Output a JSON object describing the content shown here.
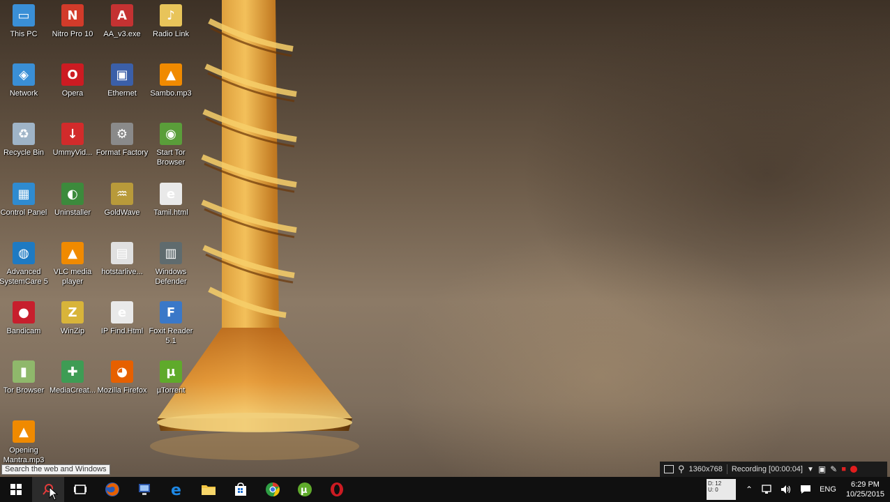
{
  "desktop": {
    "icons": [
      {
        "label": "This PC",
        "icon": "this-pc-icon",
        "color": "#3a8fd6"
      },
      {
        "label": "Nitro Pro 10",
        "icon": "nitro-pro-icon",
        "color": "#d23b2a"
      },
      {
        "label": "AA_v3.exe",
        "icon": "ammyy-admin-icon",
        "color": "#c43232"
      },
      {
        "label": "Radio Link",
        "icon": "radio-link-icon",
        "color": "#e8c45a"
      },
      {
        "label": "Network",
        "icon": "network-icon",
        "color": "#3a8fd6"
      },
      {
        "label": "Opera",
        "icon": "opera-icon",
        "color": "#cc1b22"
      },
      {
        "label": "Ethernet",
        "icon": "ethernet-icon",
        "color": "#3b5fa8"
      },
      {
        "label": "Sambo.mp3",
        "icon": "vlc-icon",
        "color": "#f08a00"
      },
      {
        "label": "Recycle Bin",
        "icon": "recycle-bin-icon",
        "color": "#9fb4c7"
      },
      {
        "label": "UmmyVid...",
        "icon": "ummy-video-icon",
        "color": "#d22b2b"
      },
      {
        "label": "Format Factory",
        "icon": "format-factory-icon",
        "color": "#8a8a8a"
      },
      {
        "label": "Start Tor Browser",
        "icon": "tor-browser-icon",
        "color": "#5a9e3a"
      },
      {
        "label": "Control Panel",
        "icon": "control-panel-icon",
        "color": "#2f8bd0"
      },
      {
        "label": "Uninstaller",
        "icon": "uninstaller-icon",
        "color": "#3c8a3c"
      },
      {
        "label": "GoldWave",
        "icon": "goldwave-icon",
        "color": "#b89a3a"
      },
      {
        "label": "Tamil.html",
        "icon": "html-file-icon",
        "color": "#e9e9e9"
      },
      {
        "label": "Advanced SystemCare 5",
        "icon": "advanced-systemcare-icon",
        "color": "#1e7ac2"
      },
      {
        "label": "VLC media player",
        "icon": "vlc-icon",
        "color": "#f08a00"
      },
      {
        "label": "hotstarlive...",
        "icon": "file-icon",
        "color": "#e0e0e0"
      },
      {
        "label": "Windows Defender",
        "icon": "windows-defender-icon",
        "color": "#5f6b6e"
      },
      {
        "label": "Bandicam",
        "icon": "bandicam-icon",
        "color": "#c71f2d"
      },
      {
        "label": "WinZip",
        "icon": "winzip-icon",
        "color": "#d8b43a"
      },
      {
        "label": "IP Find.Html",
        "icon": "html-file-icon",
        "color": "#e9e9e9"
      },
      {
        "label": "Foxit Reader 5.1",
        "icon": "foxit-reader-icon",
        "color": "#3a78c8"
      },
      {
        "label": "Tor Browser",
        "icon": "tor-folder-icon",
        "color": "#8fb86b"
      },
      {
        "label": "MediaCreat...",
        "icon": "media-creation-tool-icon",
        "color": "#3e9c54"
      },
      {
        "label": "Mozilla Firefox",
        "icon": "firefox-icon",
        "color": "#e66000"
      },
      {
        "label": "µTorrent",
        "icon": "utorrent-icon",
        "color": "#5faa2b"
      },
      {
        "label": "Opening Mantra.mp3",
        "icon": "vlc-icon",
        "color": "#f08a00"
      }
    ]
  },
  "tooltip": {
    "text": "Search the web and Windows"
  },
  "recording": {
    "resolution": "1360x768",
    "status": "Recording [00:00:04]"
  },
  "taskbar": {
    "items": [
      {
        "name": "start-button",
        "icon": "windows-start-icon"
      },
      {
        "name": "search-button",
        "icon": "search-icon"
      },
      {
        "name": "task-view-button",
        "icon": "task-view-icon"
      },
      {
        "name": "taskbar-firefox",
        "icon": "firefox-icon"
      },
      {
        "name": "taskbar-network-app",
        "icon": "network-app-icon"
      },
      {
        "name": "taskbar-edge",
        "icon": "edge-icon"
      },
      {
        "name": "taskbar-file-explorer",
        "icon": "folder-icon"
      },
      {
        "name": "taskbar-store",
        "icon": "store-icon"
      },
      {
        "name": "taskbar-chrome",
        "icon": "chrome-icon"
      },
      {
        "name": "taskbar-utorrent",
        "icon": "utorrent-icon"
      },
      {
        "name": "taskbar-opera",
        "icon": "opera-icon"
      }
    ],
    "meter": {
      "line1": "D: 12",
      "line2": "U: 0"
    },
    "language": "ENG",
    "time": "6:29 PM",
    "date": "10/25/2015"
  }
}
